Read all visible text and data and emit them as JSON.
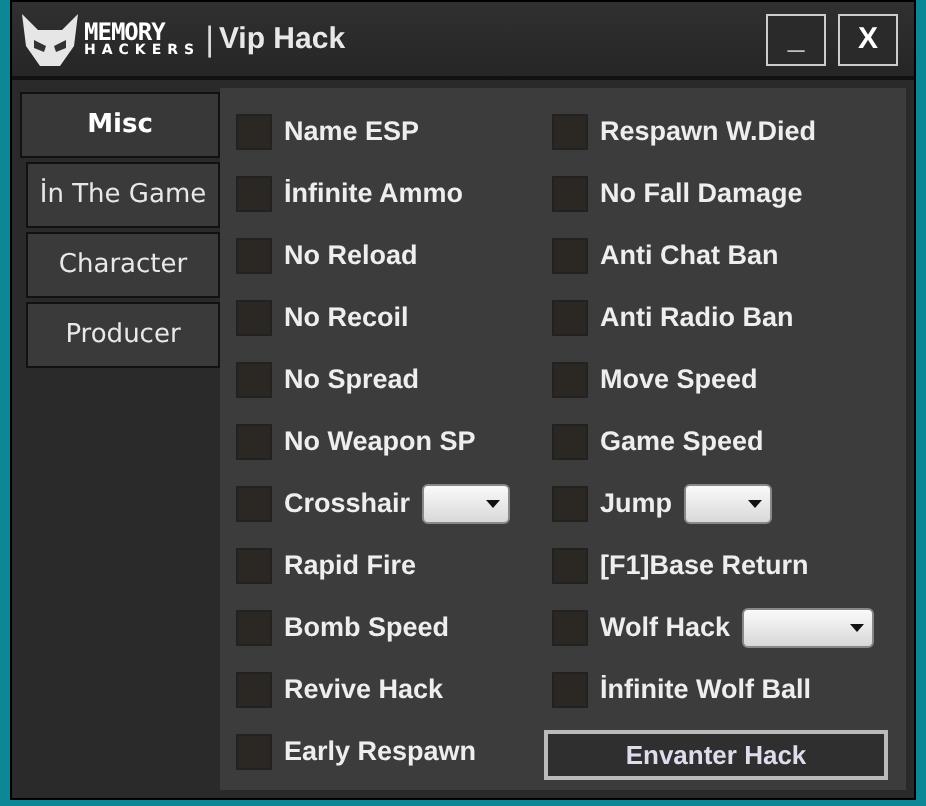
{
  "window": {
    "logo_top": "MEMORY",
    "logo_bottom": "HACKERS",
    "separator": "|",
    "title": "Vip Hack",
    "minimize": "_",
    "close": "X"
  },
  "tabs": [
    {
      "label": "Misc",
      "selected": true
    },
    {
      "label": "İn  The Game",
      "selected": false
    },
    {
      "label": "Character",
      "selected": false
    },
    {
      "label": "Producer",
      "selected": false
    }
  ],
  "options": [
    [
      {
        "kind": "checkbox",
        "label": "Name ESP",
        "checked": false
      },
      {
        "kind": "checkbox",
        "label": "İnfinite Ammo",
        "checked": false
      },
      {
        "kind": "checkbox",
        "label": "No Reload",
        "checked": false
      },
      {
        "kind": "checkbox",
        "label": "No Recoil",
        "checked": false
      },
      {
        "kind": "checkbox",
        "label": "No Spread",
        "checked": false
      },
      {
        "kind": "checkbox",
        "label": "No Weapon SP",
        "checked": false
      },
      {
        "kind": "dropdown",
        "label": "Crosshair",
        "checked": false
      },
      {
        "kind": "checkbox",
        "label": "Rapid Fire",
        "checked": false
      },
      {
        "kind": "checkbox",
        "label": "Bomb Speed",
        "checked": false
      },
      {
        "kind": "checkbox",
        "label": "Revive Hack",
        "checked": false
      },
      {
        "kind": "checkbox",
        "label": "Early Respawn",
        "checked": false
      }
    ],
    [
      {
        "kind": "checkbox",
        "label": "Respawn W.Died",
        "checked": false
      },
      {
        "kind": "checkbox",
        "label": "No Fall Damage",
        "checked": false
      },
      {
        "kind": "checkbox",
        "label": "Anti Chat Ban",
        "checked": false
      },
      {
        "kind": "checkbox",
        "label": "Anti Radio Ban",
        "checked": false
      },
      {
        "kind": "checkbox",
        "label": "Move Speed",
        "checked": false
      },
      {
        "kind": "checkbox",
        "label": "Game Speed",
        "checked": false
      },
      {
        "kind": "dropdown",
        "label": "Jump",
        "checked": false
      },
      {
        "kind": "checkbox",
        "label": "[F1]Base Return",
        "checked": false
      },
      {
        "kind": "wide-dropdown",
        "label": "Wolf Hack",
        "checked": false
      },
      {
        "kind": "checkbox",
        "label": "İnfinite Wolf Ball",
        "checked": false
      },
      {
        "kind": "button",
        "label": "Envanter Hack"
      }
    ]
  ]
}
